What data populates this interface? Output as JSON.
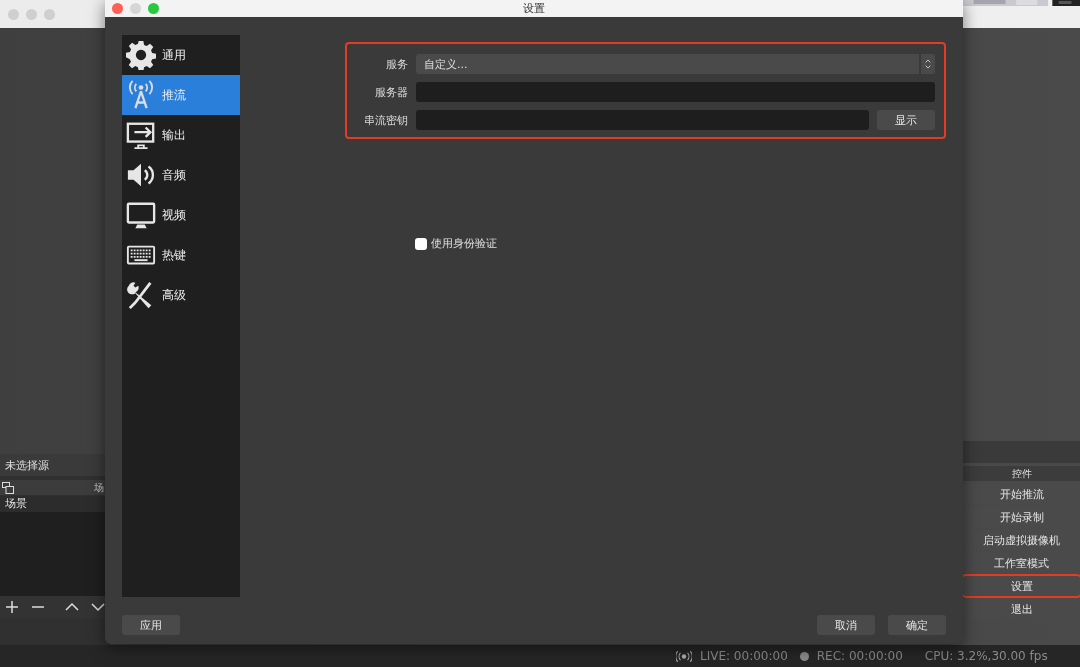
{
  "dialog": {
    "title": "设置",
    "sidebar": [
      {
        "label": "通用",
        "kind": "gear",
        "selected": false
      },
      {
        "label": "推流",
        "kind": "antenna",
        "selected": true
      },
      {
        "label": "输出",
        "kind": "output",
        "selected": false
      },
      {
        "label": "音频",
        "kind": "speaker",
        "selected": false
      },
      {
        "label": "视频",
        "kind": "monitor",
        "selected": false
      },
      {
        "label": "热键",
        "kind": "keyboard",
        "selected": false
      },
      {
        "label": "高级",
        "kind": "tools",
        "selected": false
      }
    ],
    "stream_form": {
      "highlighted": true,
      "service_label": "服务",
      "service_value": "自定义...",
      "server_label": "服务器",
      "key_label": "串流密钥",
      "show_button": "显示"
    },
    "auth_checkbox": {
      "label": "使用身份验证",
      "checked": false
    },
    "apply_button": "应用",
    "cancel_button": "取消",
    "ok_button": "确定"
  },
  "main": {
    "source_label": "未选择源",
    "scenes_header": "场",
    "scenes": [
      {
        "label": "场景",
        "selected": true
      }
    ],
    "controls_header": "控件",
    "controls": [
      {
        "label": "开始推流",
        "highlighted": false
      },
      {
        "label": "开始录制",
        "highlighted": false
      },
      {
        "label": "启动虚拟摄像机",
        "highlighted": false
      },
      {
        "label": "工作室模式",
        "highlighted": false
      },
      {
        "label": "设置",
        "highlighted": true
      },
      {
        "label": "退出",
        "highlighted": false
      }
    ],
    "status_bar": {
      "live": "LIVE: 00:00:00",
      "rec": "REC: 00:00:00",
      "cpu": "CPU: 3.2%,30.00 fps"
    }
  }
}
